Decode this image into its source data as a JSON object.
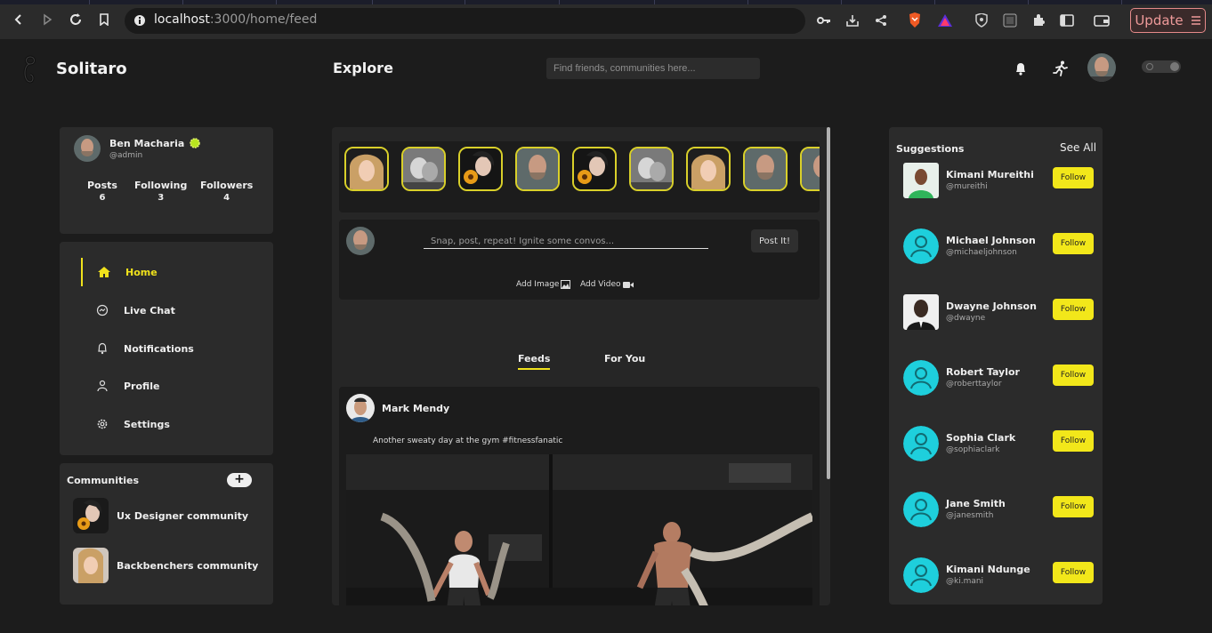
{
  "browser": {
    "url_host": "localhost",
    "url_rest": ":3000/home/feed",
    "update_label": "Update"
  },
  "header": {
    "brand": "Solitaro",
    "page_title": "Explore",
    "search_placeholder": "Find friends, communities here..."
  },
  "profile": {
    "name": "Ben Macharia",
    "handle": "@admin",
    "stats": [
      {
        "label": "Posts",
        "value": "6"
      },
      {
        "label": "Following",
        "value": "3"
      },
      {
        "label": "Followers",
        "value": "4"
      }
    ]
  },
  "nav": {
    "items": [
      {
        "label": "Home",
        "icon": "home-icon"
      },
      {
        "label": "Live Chat",
        "icon": "messenger-icon"
      },
      {
        "label": "Notifications",
        "icon": "bell-icon"
      },
      {
        "label": "Profile",
        "icon": "user-icon"
      },
      {
        "label": "Settings",
        "icon": "gear-icon"
      }
    ]
  },
  "communities": {
    "title": "Communities",
    "add_label": "+",
    "items": [
      {
        "name": "Ux Designer community"
      },
      {
        "name": "Backbenchers community"
      }
    ]
  },
  "composer": {
    "placeholder": "Snap, post, repeat! Ignite some convos...",
    "post_label": "Post It!",
    "add_image": "Add Image",
    "add_video": "Add Video"
  },
  "feed_tabs": {
    "feeds": "Feeds",
    "for_you": "For You"
  },
  "post": {
    "author": "Mark Mendy",
    "text": "Another sweaty day at the gym #fitnessfanatic"
  },
  "suggestions": {
    "title": "Suggestions",
    "see_all": "See All",
    "follow_label": "Follow",
    "items": [
      {
        "name": "Kimani Mureithi",
        "handle": "@mureithi"
      },
      {
        "name": "Michael Johnson",
        "handle": "@michaeljohnson"
      },
      {
        "name": "Dwayne Johnson",
        "handle": "@dwayne"
      },
      {
        "name": "Robert Taylor",
        "handle": "@roberttaylor"
      },
      {
        "name": "Sophia Clark",
        "handle": "@sophiaclark"
      },
      {
        "name": "Jane Smith",
        "handle": "@janesmith"
      },
      {
        "name": "Kimani Ndunge",
        "handle": "@ki.mani"
      }
    ]
  },
  "colors": {
    "accent": "#f0e21c",
    "follow_button": "#f2e71a",
    "avatar_placeholder": "#1ecfdc"
  }
}
